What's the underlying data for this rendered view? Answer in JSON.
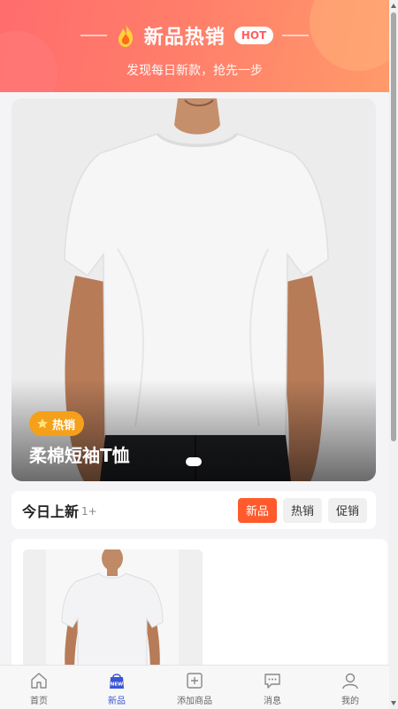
{
  "header": {
    "title": "新品热销",
    "hot_badge": "HOT",
    "subtitle": "发现每日新款，抢先一步"
  },
  "hero": {
    "tag": "热销",
    "title": "柔棉短袖T恤",
    "image": "white-tshirt-model"
  },
  "filter": {
    "title": "今日上新",
    "count": "1+",
    "chips": [
      "新品",
      "热销",
      "促销"
    ],
    "active_chip": "新品"
  },
  "products": [
    {
      "image": "white-tshirt-model"
    }
  ],
  "nav": {
    "items": [
      {
        "label": "首页",
        "icon": "home-icon"
      },
      {
        "label": "新品",
        "icon": "new-bag-icon",
        "active": true
      },
      {
        "label": "添加商品",
        "icon": "add-square-icon"
      },
      {
        "label": "消息",
        "icon": "message-icon"
      },
      {
        "label": "我的",
        "icon": "user-icon"
      }
    ]
  },
  "colors": {
    "accent": "#ff5b2c",
    "nav_active": "#3a56d4",
    "tag": "#f5a01a"
  }
}
